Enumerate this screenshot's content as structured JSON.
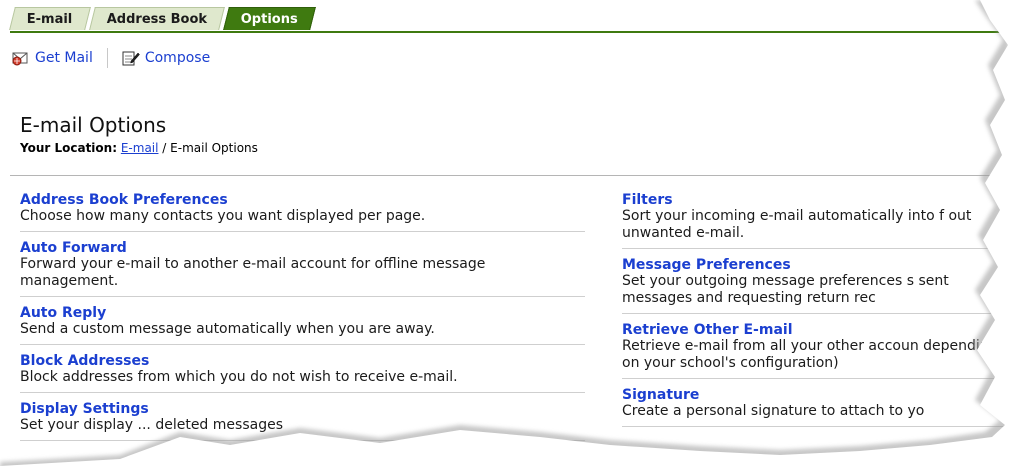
{
  "tabs": [
    {
      "label": "E-mail"
    },
    {
      "label": "Address Book"
    },
    {
      "label": "Options"
    }
  ],
  "toolbar": {
    "get_mail": "Get Mail",
    "compose": "Compose"
  },
  "page": {
    "title": "E-mail Options",
    "location_label": "Your Location:",
    "location_link": "E-mail",
    "location_sep": "/",
    "location_current": "E-mail Options"
  },
  "options_left": [
    {
      "name": "Address Book Preferences",
      "desc": "Choose how many contacts you want displayed per page."
    },
    {
      "name": "Auto Forward",
      "desc": "Forward your e-mail to another e-mail account for offline message management."
    },
    {
      "name": "Auto Reply",
      "desc": "Send a custom message automatically when you are away."
    },
    {
      "name": "Block Addresses",
      "desc": "Block addresses from which you do not wish to receive e-mail."
    },
    {
      "name": "Display Settings",
      "desc": "Set your display ... deleted messages"
    }
  ],
  "options_right": [
    {
      "name": "Filters",
      "desc": "Sort your incoming e-mail automatically into f out unwanted e-mail."
    },
    {
      "name": "Message Preferences",
      "desc": "Set your outgoing message preferences s sent messages and requesting return rec"
    },
    {
      "name": "Retrieve Other E-mail",
      "desc": "Retrieve e-mail from all your other accoun depending on your school's configuration)"
    },
    {
      "name": "Signature",
      "desc": "Create a personal signature to attach to yo"
    }
  ],
  "colors": {
    "tab_active": "#3f7a10",
    "tab_inactive": "#dfe8cd",
    "link": "#1b3fd0"
  },
  "icons": {
    "get_mail": "envelope-globe-icon",
    "compose": "compose-pencil-icon"
  }
}
